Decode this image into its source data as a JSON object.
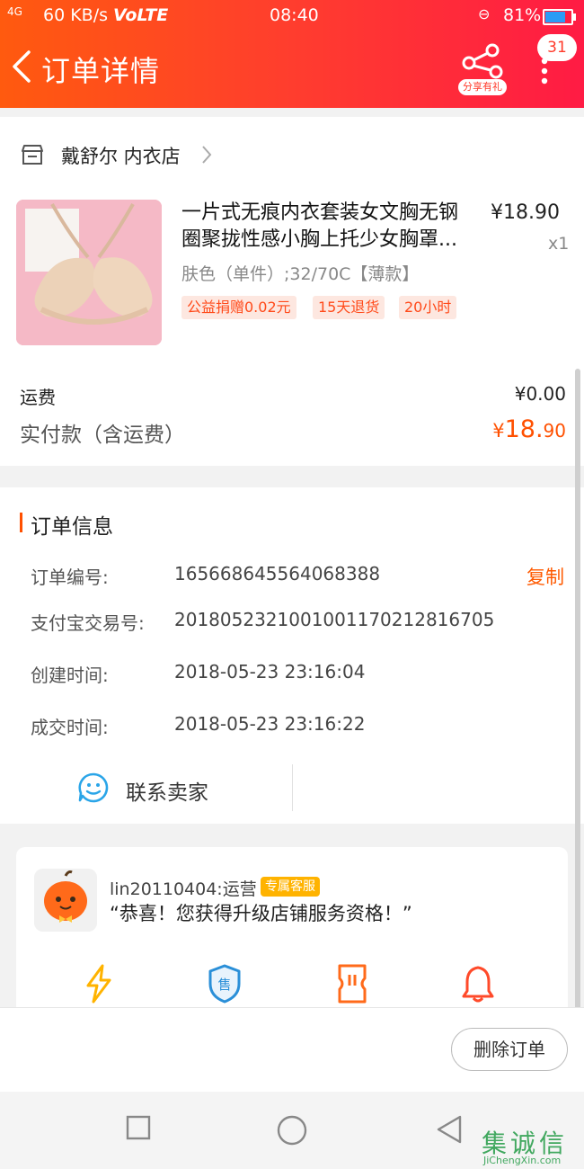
{
  "status_bar": {
    "signal": "4G",
    "speed": "60 KB/s",
    "volte": "VoLTE",
    "time": "08:40",
    "battery": "81%"
  },
  "header": {
    "title": "订单详情",
    "share_label": "分享有礼",
    "badge_count": "31"
  },
  "shop": {
    "name": "戴舒尔 内衣店"
  },
  "product": {
    "title_line1": "一片式无痕内衣套装女文胸无钢",
    "title_line2": "圈聚拢性感小胸上托少女胸罩...",
    "price": "¥18.90",
    "quantity": "x1",
    "sku": "肤色（单件）;32/70C【薄款】",
    "tags": [
      "公益捐赠0.02元",
      "15天退货",
      "20小时"
    ]
  },
  "fees": {
    "shipping_label": "运费",
    "shipping_value": "¥0.00",
    "paid_label": "实付款（含运费）",
    "paid_currency": "¥",
    "paid_integer": "18.",
    "paid_decimal": "90"
  },
  "order_info": {
    "section_title": "订单信息",
    "rows": [
      {
        "label": "订单编号:",
        "value": "165668645564068388"
      },
      {
        "label": "支付宝交易号:",
        "value": "2018052321001001170212816705"
      },
      {
        "label": "创建时间:",
        "value": "2018-05-23 23:16:04"
      },
      {
        "label": "成交时间:",
        "value": "2018-05-23 23:16:22"
      }
    ],
    "copy_label": "复制",
    "contact_label": "联系卖家"
  },
  "promo": {
    "operator": "lin20110404:运营",
    "vip_tag": "专属客服",
    "message": "“恭喜！您获得升级店铺服务资格！”",
    "icons": [
      "lightning-icon",
      "shield-sale-icon",
      "ticket-icon",
      "bell-icon"
    ]
  },
  "actions": {
    "delete_label": "删除订单"
  },
  "watermark": {
    "text": "集诚信",
    "sub": "JiChengXin.com"
  },
  "colors": {
    "accent": "#ff5000",
    "header_start": "#ff5a0f",
    "header_end": "#ff1b44",
    "tag_bg": "#fde7e0",
    "vip": "#ffb300",
    "contact_blue": "#2aa5e8"
  }
}
